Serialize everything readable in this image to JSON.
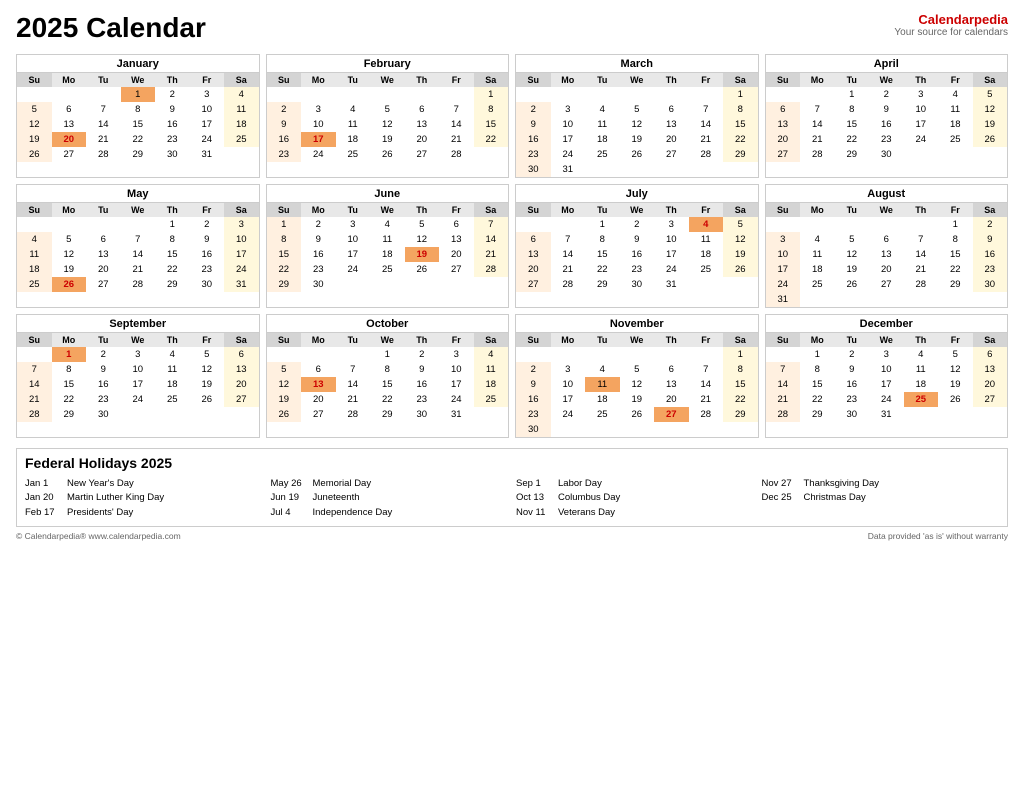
{
  "title": "2025 Calendar",
  "brand": {
    "name1": "Calendar",
    "name2": "pedia",
    "tagline": "Your source for calendars"
  },
  "months": [
    {
      "name": "January",
      "weeks": [
        [
          "",
          "",
          "",
          "1",
          "2",
          "3",
          "4"
        ],
        [
          "5",
          "6",
          "7",
          "8",
          "9",
          "10",
          "11"
        ],
        [
          "12",
          "13",
          "14",
          "15",
          "16",
          "17",
          "18"
        ],
        [
          "19",
          "20",
          "21",
          "22",
          "23",
          "24",
          "25"
        ],
        [
          "26",
          "27",
          "28",
          "29",
          "30",
          "31",
          ""
        ]
      ],
      "holidays": {
        "1": "h",
        "20": "h"
      },
      "red": {
        "20": true
      },
      "saSu": {}
    },
    {
      "name": "February",
      "weeks": [
        [
          "",
          "",
          "",
          "",
          "",
          "",
          "1"
        ],
        [
          "2",
          "3",
          "4",
          "5",
          "6",
          "7",
          "8"
        ],
        [
          "9",
          "10",
          "11",
          "12",
          "13",
          "14",
          "15"
        ],
        [
          "16",
          "17",
          "18",
          "19",
          "20",
          "21",
          "22"
        ],
        [
          "23",
          "24",
          "25",
          "26",
          "27",
          "28",
          ""
        ]
      ],
      "holidays": {
        "17": "h"
      },
      "red": {
        "17": true
      },
      "saSu": {}
    },
    {
      "name": "March",
      "weeks": [
        [
          "",
          "",
          "",
          "",
          "",
          "",
          "1"
        ],
        [
          "2",
          "3",
          "4",
          "5",
          "6",
          "7",
          "8"
        ],
        [
          "9",
          "10",
          "11",
          "12",
          "13",
          "14",
          "15"
        ],
        [
          "16",
          "17",
          "18",
          "19",
          "20",
          "21",
          "22"
        ],
        [
          "23",
          "24",
          "25",
          "26",
          "27",
          "28",
          "29"
        ],
        [
          "30",
          "31",
          "",
          "",
          "",
          "",
          ""
        ]
      ],
      "holidays": {},
      "red": {},
      "saSu": {}
    },
    {
      "name": "April",
      "weeks": [
        [
          "",
          "",
          "1",
          "2",
          "3",
          "4",
          "5"
        ],
        [
          "6",
          "7",
          "8",
          "9",
          "10",
          "11",
          "12"
        ],
        [
          "13",
          "14",
          "15",
          "16",
          "17",
          "18",
          "19"
        ],
        [
          "20",
          "21",
          "22",
          "23",
          "24",
          "25",
          "26"
        ],
        [
          "27",
          "28",
          "29",
          "30",
          "",
          "",
          ""
        ]
      ],
      "holidays": {},
      "red": {},
      "saSu": {}
    },
    {
      "name": "May",
      "weeks": [
        [
          "",
          "",
          "",
          "",
          "1",
          "2",
          "3"
        ],
        [
          "4",
          "5",
          "6",
          "7",
          "8",
          "9",
          "10"
        ],
        [
          "11",
          "12",
          "13",
          "14",
          "15",
          "16",
          "17"
        ],
        [
          "18",
          "19",
          "20",
          "21",
          "22",
          "23",
          "24"
        ],
        [
          "25",
          "26",
          "27",
          "28",
          "29",
          "30",
          "31"
        ]
      ],
      "holidays": {
        "26": "h"
      },
      "red": {
        "26": true
      },
      "saSu": {}
    },
    {
      "name": "June",
      "weeks": [
        [
          "1",
          "2",
          "3",
          "4",
          "5",
          "6",
          "7"
        ],
        [
          "8",
          "9",
          "10",
          "11",
          "12",
          "13",
          "14"
        ],
        [
          "15",
          "16",
          "17",
          "18",
          "19",
          "20",
          "21"
        ],
        [
          "22",
          "23",
          "24",
          "25",
          "26",
          "27",
          "28"
        ],
        [
          "29",
          "30",
          "",
          "",
          "",
          "",
          ""
        ]
      ],
      "holidays": {
        "19": "h"
      },
      "red": {
        "19": true
      },
      "saSu": {}
    },
    {
      "name": "July",
      "weeks": [
        [
          "",
          "",
          "1",
          "2",
          "3",
          "4",
          "5"
        ],
        [
          "6",
          "7",
          "8",
          "9",
          "10",
          "11",
          "12"
        ],
        [
          "13",
          "14",
          "15",
          "16",
          "17",
          "18",
          "19"
        ],
        [
          "20",
          "21",
          "22",
          "23",
          "24",
          "25",
          "26"
        ],
        [
          "27",
          "28",
          "29",
          "30",
          "31",
          "",
          ""
        ]
      ],
      "holidays": {
        "4": "h"
      },
      "red": {
        "4": true
      },
      "saSu": {}
    },
    {
      "name": "August",
      "weeks": [
        [
          "",
          "",
          "",
          "",
          "",
          "1",
          "2"
        ],
        [
          "3",
          "4",
          "5",
          "6",
          "7",
          "8",
          "9"
        ],
        [
          "10",
          "11",
          "12",
          "13",
          "14",
          "15",
          "16"
        ],
        [
          "17",
          "18",
          "19",
          "20",
          "21",
          "22",
          "23"
        ],
        [
          "24",
          "25",
          "26",
          "27",
          "28",
          "29",
          "30"
        ],
        [
          "31",
          "",
          "",
          "",
          "",
          "",
          ""
        ]
      ],
      "holidays": {},
      "red": {},
      "saSu": {}
    },
    {
      "name": "September",
      "weeks": [
        [
          "",
          "1",
          "2",
          "3",
          "4",
          "5",
          "6"
        ],
        [
          "7",
          "8",
          "9",
          "10",
          "11",
          "12",
          "13"
        ],
        [
          "14",
          "15",
          "16",
          "17",
          "18",
          "19",
          "20"
        ],
        [
          "21",
          "22",
          "23",
          "24",
          "25",
          "26",
          "27"
        ],
        [
          "28",
          "29",
          "30",
          "",
          "",
          "",
          ""
        ]
      ],
      "holidays": {
        "1": "h"
      },
      "red": {
        "1": true
      },
      "saSu": {}
    },
    {
      "name": "October",
      "weeks": [
        [
          "",
          "",
          "",
          "1",
          "2",
          "3",
          "4"
        ],
        [
          "5",
          "6",
          "7",
          "8",
          "9",
          "10",
          "11"
        ],
        [
          "12",
          "13",
          "14",
          "15",
          "16",
          "17",
          "18"
        ],
        [
          "19",
          "20",
          "21",
          "22",
          "23",
          "24",
          "25"
        ],
        [
          "26",
          "27",
          "28",
          "29",
          "30",
          "31",
          ""
        ]
      ],
      "holidays": {
        "13": "h"
      },
      "red": {
        "13": true
      },
      "saSu": {}
    },
    {
      "name": "November",
      "weeks": [
        [
          "",
          "",
          "",
          "",
          "",
          "",
          "1"
        ],
        [
          "2",
          "3",
          "4",
          "5",
          "6",
          "7",
          "8"
        ],
        [
          "9",
          "10",
          "11",
          "12",
          "13",
          "14",
          "15"
        ],
        [
          "16",
          "17",
          "18",
          "19",
          "20",
          "21",
          "22"
        ],
        [
          "23",
          "24",
          "25",
          "26",
          "27",
          "28",
          "29"
        ],
        [
          "30",
          "",
          "",
          "",
          "",
          "",
          ""
        ]
      ],
      "holidays": {
        "11": "h",
        "27": "h"
      },
      "red": {
        "27": true
      },
      "saSu": {}
    },
    {
      "name": "December",
      "weeks": [
        [
          "",
          "1",
          "2",
          "3",
          "4",
          "5",
          "6"
        ],
        [
          "7",
          "8",
          "9",
          "10",
          "11",
          "12",
          "13"
        ],
        [
          "14",
          "15",
          "16",
          "17",
          "18",
          "19",
          "20"
        ],
        [
          "21",
          "22",
          "23",
          "24",
          "25",
          "26",
          "27"
        ],
        [
          "28",
          "29",
          "30",
          "31",
          "",
          "",
          ""
        ]
      ],
      "holidays": {
        "25": "h"
      },
      "red": {
        "25": true
      },
      "saSu": {}
    }
  ],
  "holidays_title": "Federal Holidays 2025",
  "holidays": [
    [
      {
        "date": "Jan 1",
        "name": "New Year's Day"
      },
      {
        "date": "Jan 20",
        "name": "Martin Luther King Day"
      },
      {
        "date": "Feb 17",
        "name": "Presidents' Day"
      }
    ],
    [
      {
        "date": "May 26",
        "name": "Memorial Day"
      },
      {
        "date": "Jun 19",
        "name": "Juneteenth"
      },
      {
        "date": "Jul 4",
        "name": "Independence Day"
      }
    ],
    [
      {
        "date": "Sep 1",
        "name": "Labor Day"
      },
      {
        "date": "Oct 13",
        "name": "Columbus Day"
      },
      {
        "date": "Nov 11",
        "name": "Veterans Day"
      }
    ],
    [
      {
        "date": "Nov 27",
        "name": "Thanksgiving Day"
      },
      {
        "date": "Dec 25",
        "name": "Christmas Day"
      }
    ]
  ],
  "footer_left": "© Calendarpedia®   www.calendarpedia.com",
  "footer_right": "Data provided 'as is' without warranty",
  "days": [
    "Su",
    "Mo",
    "Tu",
    "We",
    "Th",
    "Fr",
    "Sa"
  ]
}
